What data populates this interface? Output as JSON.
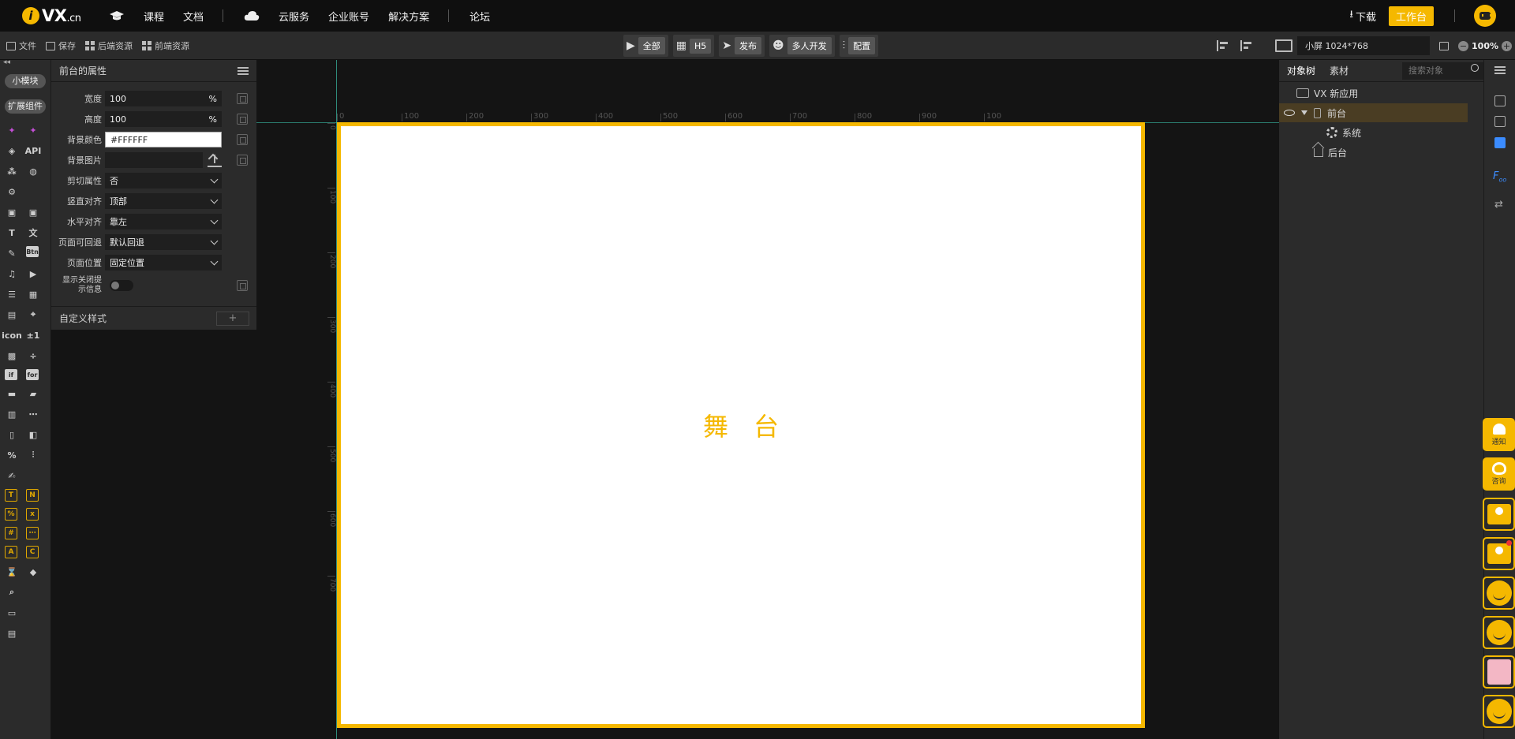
{
  "brand": {
    "logo_letter": "i",
    "logo_text": "VX",
    "logo_suffix": ".cn"
  },
  "topnav": {
    "courses": "课程",
    "docs": "文档",
    "cloud": "云服务",
    "enterprise": "企业账号",
    "solutions": "解决方案",
    "forum": "论坛",
    "download": "下载",
    "workbench": "工作台"
  },
  "toolbar": {
    "file": "文件",
    "save": "保存",
    "backend_res": "后端资源",
    "frontend_res": "前端资源",
    "run_all": "全部",
    "h5": "H5",
    "publish": "发布",
    "multi_dev": "多人开发",
    "config": "配置",
    "screen_size": "小屏 1024*768",
    "zoom": "100%"
  },
  "rail": {
    "small_module": "小模块",
    "extension": "扩展组件",
    "icons": [
      "puzzle-icon",
      "puzzle-alt-icon",
      "cube-icon",
      "API",
      "molecule-icon",
      "wechat-icon",
      "gear-icon",
      "",
      "image-icon",
      "image-alt-icon",
      "T",
      "translate-icon",
      "edit-icon",
      "Btn",
      "music-icon",
      "video-icon",
      "list-icon",
      "calendar-icon",
      "editor-icon",
      "map-icon",
      "icon",
      "±1",
      "qrcode-icon",
      "divider-icon",
      "if",
      "for",
      "folder-icon",
      "note-icon",
      "gallery-icon",
      "more-icon",
      "slider-icon",
      "pm-icon",
      "percent-icon",
      "adjust-icon",
      "sign-icon",
      ""
    ]
  },
  "props": {
    "title": "前台的属性",
    "width_label": "宽度",
    "width_value": "100",
    "width_unit": "%",
    "height_label": "高度",
    "height_value": "100",
    "height_unit": "%",
    "bg_color_label": "背景颜色",
    "bg_color_value": "#FFFFFF",
    "bg_image_label": "背景图片",
    "clip_label": "剪切属性",
    "clip_value": "否",
    "valign_label": "竖直对齐",
    "valign_value": "顶部",
    "halign_label": "水平对齐",
    "halign_value": "靠左",
    "back_label": "页面可回退",
    "back_value": "默认回退",
    "pos_label": "页面位置",
    "pos_value": "固定位置",
    "close_tip_label_1": "显示关闭提",
    "close_tip_label_2": "示信息",
    "custom_style": "自定义样式",
    "plus": "+"
  },
  "canvas": {
    "stage_label": "舞台",
    "ruler_h": [
      "0",
      "100",
      "200",
      "300",
      "400",
      "500",
      "600",
      "700",
      "800",
      "900",
      "100"
    ],
    "ruler_v": [
      "0",
      "100",
      "200",
      "300",
      "400",
      "500",
      "600",
      "700"
    ]
  },
  "rpanel": {
    "tab_tree": "对象树",
    "tab_assets": "素材",
    "search_placeholder": "搜索对象",
    "tree": {
      "app": "VX 新应用",
      "front": "前台",
      "system": "系统",
      "back": "后台"
    }
  },
  "floating": {
    "notify": "通知",
    "consult": "咨询"
  },
  "colors": {
    "accent": "#f5b800",
    "guide": "#3bbfa8",
    "panel": "#2b2b2b"
  }
}
